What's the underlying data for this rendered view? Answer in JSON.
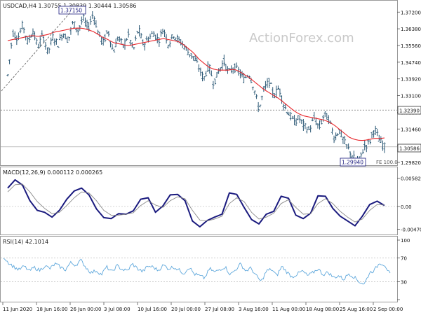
{
  "colors": {
    "background": "#ffffff",
    "price_bars": "#2b5875",
    "ma_line": "#e8262b",
    "macd_line": "#1a1a7e",
    "signal_line": "#8a8a8a",
    "rsi_line": "#5fa8dc",
    "level_line": "#6e6e6e",
    "watermark": "#c9c9c9",
    "frame": "#9a9a9a"
  },
  "watermark": "ActionForex.com",
  "chart_data": [
    {
      "type": "ohlc",
      "symbol_header": "USDCAD,H4  1.30755 1.30839 1.30444 1.30586",
      "ylim": [
        1.2982,
        1.3745
      ],
      "y_ticks": [
        "1.37200",
        "1.36380",
        "1.35560",
        "1.34740",
        "1.33920",
        "1.33100",
        "1.32280",
        "1.31460",
        "1.30640",
        "1.29820"
      ],
      "x_ticks": [
        "11 Jun 2020",
        "18 Jun 16:00",
        "26 Jun 00:00",
        "3 Jul 08:00",
        "10 Jul 16:00",
        "20 Jul 00:00",
        "27 Jul 08:00",
        "3 Aug 16:00",
        "11 Aug 00:00",
        "18 Aug 08:00",
        "25 Aug 16:00",
        "2 Sep 00:00"
      ],
      "price_path": [
        1.341,
        1.362,
        1.359,
        1.366,
        1.357,
        1.363,
        1.355,
        1.361,
        1.352,
        1.36,
        1.356,
        1.362,
        1.358,
        1.367,
        1.363,
        1.369,
        1.364,
        1.3715,
        1.362,
        1.357,
        1.363,
        1.352,
        1.36,
        1.355,
        1.361,
        1.353,
        1.364,
        1.356,
        1.359,
        1.362,
        1.358,
        1.364,
        1.356,
        1.361,
        1.358,
        1.356,
        1.352,
        1.35,
        1.345,
        1.339,
        1.346,
        1.337,
        1.343,
        1.348,
        1.342,
        1.345,
        1.343,
        1.339,
        1.342,
        1.335,
        1.324,
        1.334,
        1.338,
        1.331,
        1.335,
        1.326,
        1.322,
        1.318,
        1.32,
        1.316,
        1.314,
        1.32,
        1.315,
        1.322,
        1.319,
        1.31,
        1.314,
        1.308,
        1.304,
        1.3,
        1.2994,
        1.306,
        1.308,
        1.315,
        1.309,
        1.3059
      ],
      "ma_path": [
        1.358,
        1.3585,
        1.359,
        1.3595,
        1.36,
        1.3605,
        1.36,
        1.3605,
        1.361,
        1.362,
        1.3625,
        1.363,
        1.3635,
        1.364,
        1.3642,
        1.364,
        1.3633,
        1.3625,
        1.361,
        1.3595,
        1.3585,
        1.357,
        1.3565,
        1.356,
        1.3555,
        1.356,
        1.3565,
        1.357,
        1.3575,
        1.358,
        1.3585,
        1.359,
        1.3585,
        1.358,
        1.3575,
        1.356,
        1.354,
        1.352,
        1.349,
        1.347,
        1.345,
        1.344,
        1.3435,
        1.3435,
        1.3435,
        1.344,
        1.343,
        1.3415,
        1.34,
        1.338,
        1.336,
        1.334,
        1.3325,
        1.331,
        1.3295,
        1.3275,
        1.3255,
        1.3235,
        1.322,
        1.321,
        1.3205,
        1.32,
        1.3195,
        1.319,
        1.318,
        1.3165,
        1.3145,
        1.3125,
        1.3105,
        1.3095,
        1.309,
        1.309,
        1.3095,
        1.31,
        1.31,
        1.3102
      ],
      "annotations": {
        "high_label": "1.37150",
        "low_label": "1.29940",
        "level_label": "1.32390",
        "price_label": "1.30586",
        "fe_label": "FE 100.0"
      }
    },
    {
      "type": "line",
      "header": "MACD(12,26,9) 0.000112 0.000265",
      "ylim": [
        -0.0055,
        0.0065
      ],
      "y_ticks": [
        "0.005821",
        "0.00",
        "-0.004701"
      ],
      "series": [
        {
          "role": "macd",
          "values": [
            0.0038,
            0.0055,
            0.0044,
            0.0012,
            -0.0008,
            -0.0012,
            -0.0022,
            -0.0008,
            0.0015,
            0.0032,
            0.0038,
            0.0024,
            -0.0005,
            -0.0023,
            -0.0025,
            -0.0015,
            -0.0016,
            -0.0009,
            0.0015,
            0.0018,
            -0.0012,
            0.0001,
            0.0024,
            0.0025,
            0.0012,
            -0.003,
            -0.0042,
            -0.0029,
            -0.0022,
            -0.0016,
            0.0028,
            0.0025,
            -0.0002,
            -0.0027,
            -0.0036,
            -0.0016,
            -0.001,
            0.0021,
            0.0017,
            -0.0018,
            -0.0025,
            -0.0014,
            0.0022,
            0.0021,
            -0.0004,
            -0.002,
            -0.003,
            -0.004,
            -0.002,
            0.0004,
            0.0011,
            0.0002
          ]
        },
        {
          "role": "signal",
          "values": [
            0.003,
            0.0045,
            0.0046,
            0.003,
            0.001,
            -0.0004,
            -0.0015,
            -0.0012,
            0.0002,
            0.0018,
            0.003,
            0.0028,
            0.0012,
            -0.0008,
            -0.0018,
            -0.0018,
            -0.0016,
            -0.0013,
            0.0002,
            0.0012,
            0.0003,
            -0.0002,
            0.0012,
            0.002,
            0.0016,
            -0.0008,
            -0.0028,
            -0.003,
            -0.0026,
            -0.002,
            0.0006,
            0.0018,
            0.001,
            -0.0012,
            -0.0026,
            -0.0022,
            -0.0014,
            0.0006,
            0.0014,
            -0.0002,
            -0.0016,
            -0.0015,
            0.0006,
            0.0016,
            0.0006,
            -0.001,
            -0.0022,
            -0.0032,
            -0.0026,
            -0.0008,
            0.0004,
            0.0003
          ]
        }
      ]
    },
    {
      "type": "line",
      "header": "RSI(14) 42.1014",
      "ylim": [
        0,
        100
      ],
      "y_ticks": [
        "100",
        "70",
        "30",
        "0"
      ],
      "levels": [
        70,
        30
      ],
      "series": [
        {
          "role": "rsi",
          "values": [
            72,
            62,
            55,
            50,
            56,
            48,
            54,
            49,
            57,
            52,
            60,
            55,
            50,
            62,
            58,
            66,
            54,
            45,
            49,
            42,
            55,
            46,
            57,
            51,
            48,
            60,
            52,
            47,
            56,
            55,
            49,
            58,
            52,
            55,
            50,
            44,
            55,
            43,
            40,
            36,
            52,
            46,
            51,
            55,
            42,
            50,
            60,
            48,
            53,
            40,
            30,
            48,
            51,
            40,
            56,
            46,
            38,
            43,
            48,
            40,
            45,
            52,
            42,
            46,
            37,
            40,
            34,
            44,
            38,
            30,
            26,
            45,
            50,
            62,
            58,
            42
          ]
        }
      ]
    }
  ]
}
